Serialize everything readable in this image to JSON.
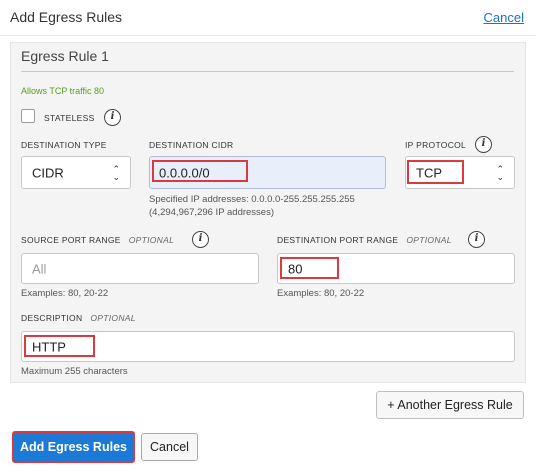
{
  "header": {
    "title": "Add Egress Rules",
    "cancel_link": "Cancel"
  },
  "rule": {
    "title": "Egress Rule 1",
    "description_note": "Allows TCP traffic 80",
    "stateless": {
      "label": "STATELESS",
      "checked": false
    },
    "destination_type": {
      "label": "DESTINATION TYPE",
      "value": "CIDR"
    },
    "destination_cidr": {
      "label": "DESTINATION CIDR",
      "value": "0.0.0.0/0",
      "help_line1": "Specified IP addresses: 0.0.0.0-255.255.255.255",
      "help_line2": "(4,294,967,296 IP addresses)"
    },
    "ip_protocol": {
      "label": "IP PROTOCOL",
      "value": "TCP"
    },
    "source_port_range": {
      "label": "SOURCE PORT RANGE",
      "optional": "OPTIONAL",
      "placeholder": "All",
      "help": "Examples: 80, 20-22"
    },
    "destination_port_range": {
      "label": "DESTINATION PORT RANGE",
      "optional": "OPTIONAL",
      "value": "80",
      "help": "Examples: 80, 20-22"
    },
    "description": {
      "label": "DESCRIPTION",
      "optional": "OPTIONAL",
      "value": "HTTP",
      "help": "Maximum 255 characters"
    }
  },
  "buttons": {
    "another_rule": "+ Another Egress Rule",
    "add_rules": "Add Egress Rules",
    "cancel": "Cancel"
  },
  "colors": {
    "primary": "#1c7ad6",
    "highlight": "#d83a40",
    "allows_note": "#5a9e1f",
    "link": "#1a73c9"
  },
  "icons": {
    "info": "info-icon",
    "stepper": "up-down-chevron-icon"
  }
}
